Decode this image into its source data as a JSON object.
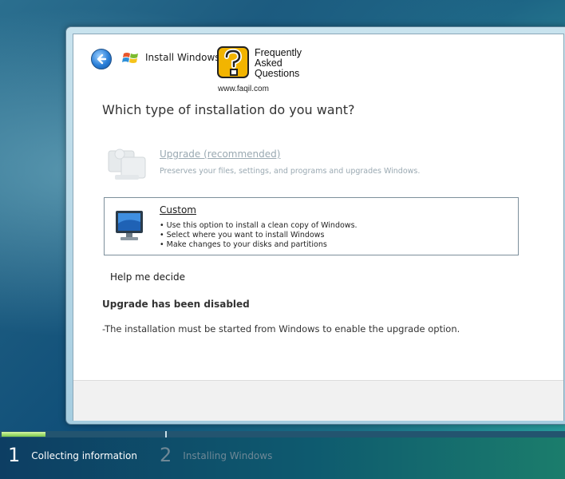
{
  "window": {
    "title": "Install Windows",
    "close_label": "✕"
  },
  "overlay_logo": {
    "text_lines": [
      "Frequently",
      "Asked",
      "Questions"
    ],
    "url": "www.faqil.com"
  },
  "main": {
    "heading": "Which type of installation do you want?",
    "options": [
      {
        "title": "Upgrade (recommended)",
        "description": "Preserves your files, settings, and programs and upgrades Windows.",
        "enabled": false
      },
      {
        "title": "Custom",
        "bullets": [
          "Use this option to install a clean copy of Windows.",
          "Select where you want to install Windows",
          "Make changes to your disks and partitions"
        ],
        "enabled": true
      }
    ],
    "help_link": "Help me decide",
    "notice_title": "Upgrade has been disabled",
    "notice_text": "-The installation must be started from Windows to enable the upgrade option."
  },
  "progress": {
    "steps": [
      {
        "number": "1",
        "label": "Collecting information",
        "active": true
      },
      {
        "number": "2",
        "label": "Installing Windows",
        "active": false
      }
    ],
    "current_step_fill_fraction": 0.27
  },
  "colors": {
    "accent_green": "#7bc94a",
    "disabled_text": "#9aa9b2",
    "close_red": "#c8452b"
  },
  "icons": [
    "back-arrow-icon",
    "windows-logo-icon",
    "faq-question-icon",
    "upgrade-computer-icon",
    "custom-monitor-icon"
  ]
}
